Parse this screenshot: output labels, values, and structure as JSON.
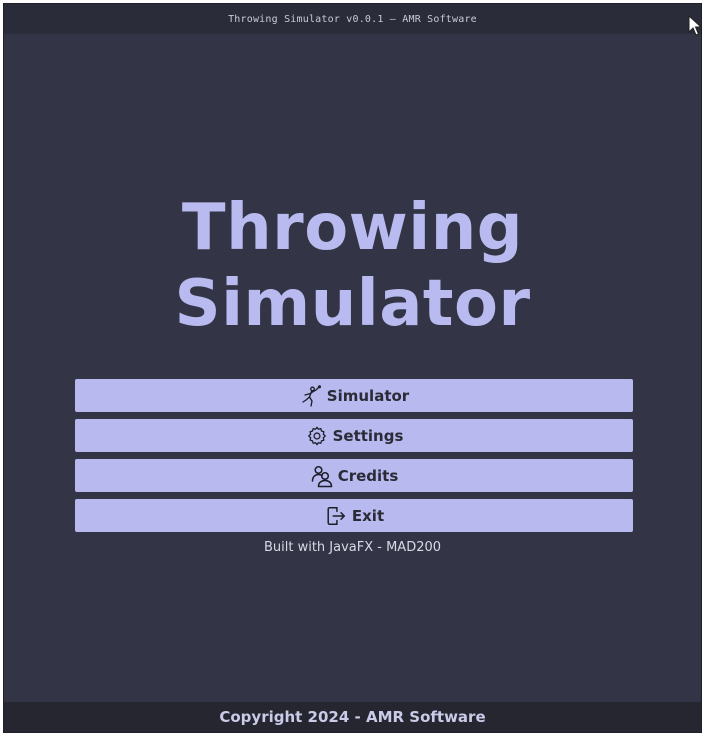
{
  "window": {
    "title": "Throwing Simulator v0.0.1 – AMR Software"
  },
  "main": {
    "title_line1": "Throwing",
    "title_line2": "Simulator",
    "buttons": [
      {
        "label": "Simulator",
        "icon": "throwing-figure-icon"
      },
      {
        "label": "Settings",
        "icon": "gear-icon"
      },
      {
        "label": "Credits",
        "icon": "people-icon"
      },
      {
        "label": "Exit",
        "icon": "exit-icon"
      }
    ],
    "built_with": "Built with JavaFX - MAD200"
  },
  "footer": {
    "copyright": "Copyright 2024 - AMR Software"
  },
  "colors": {
    "background": "#333546",
    "accent": "#b7b9ef",
    "title": "#b9bbf0",
    "button_text": "#2a2b36",
    "footer_bg": "#25262f"
  }
}
